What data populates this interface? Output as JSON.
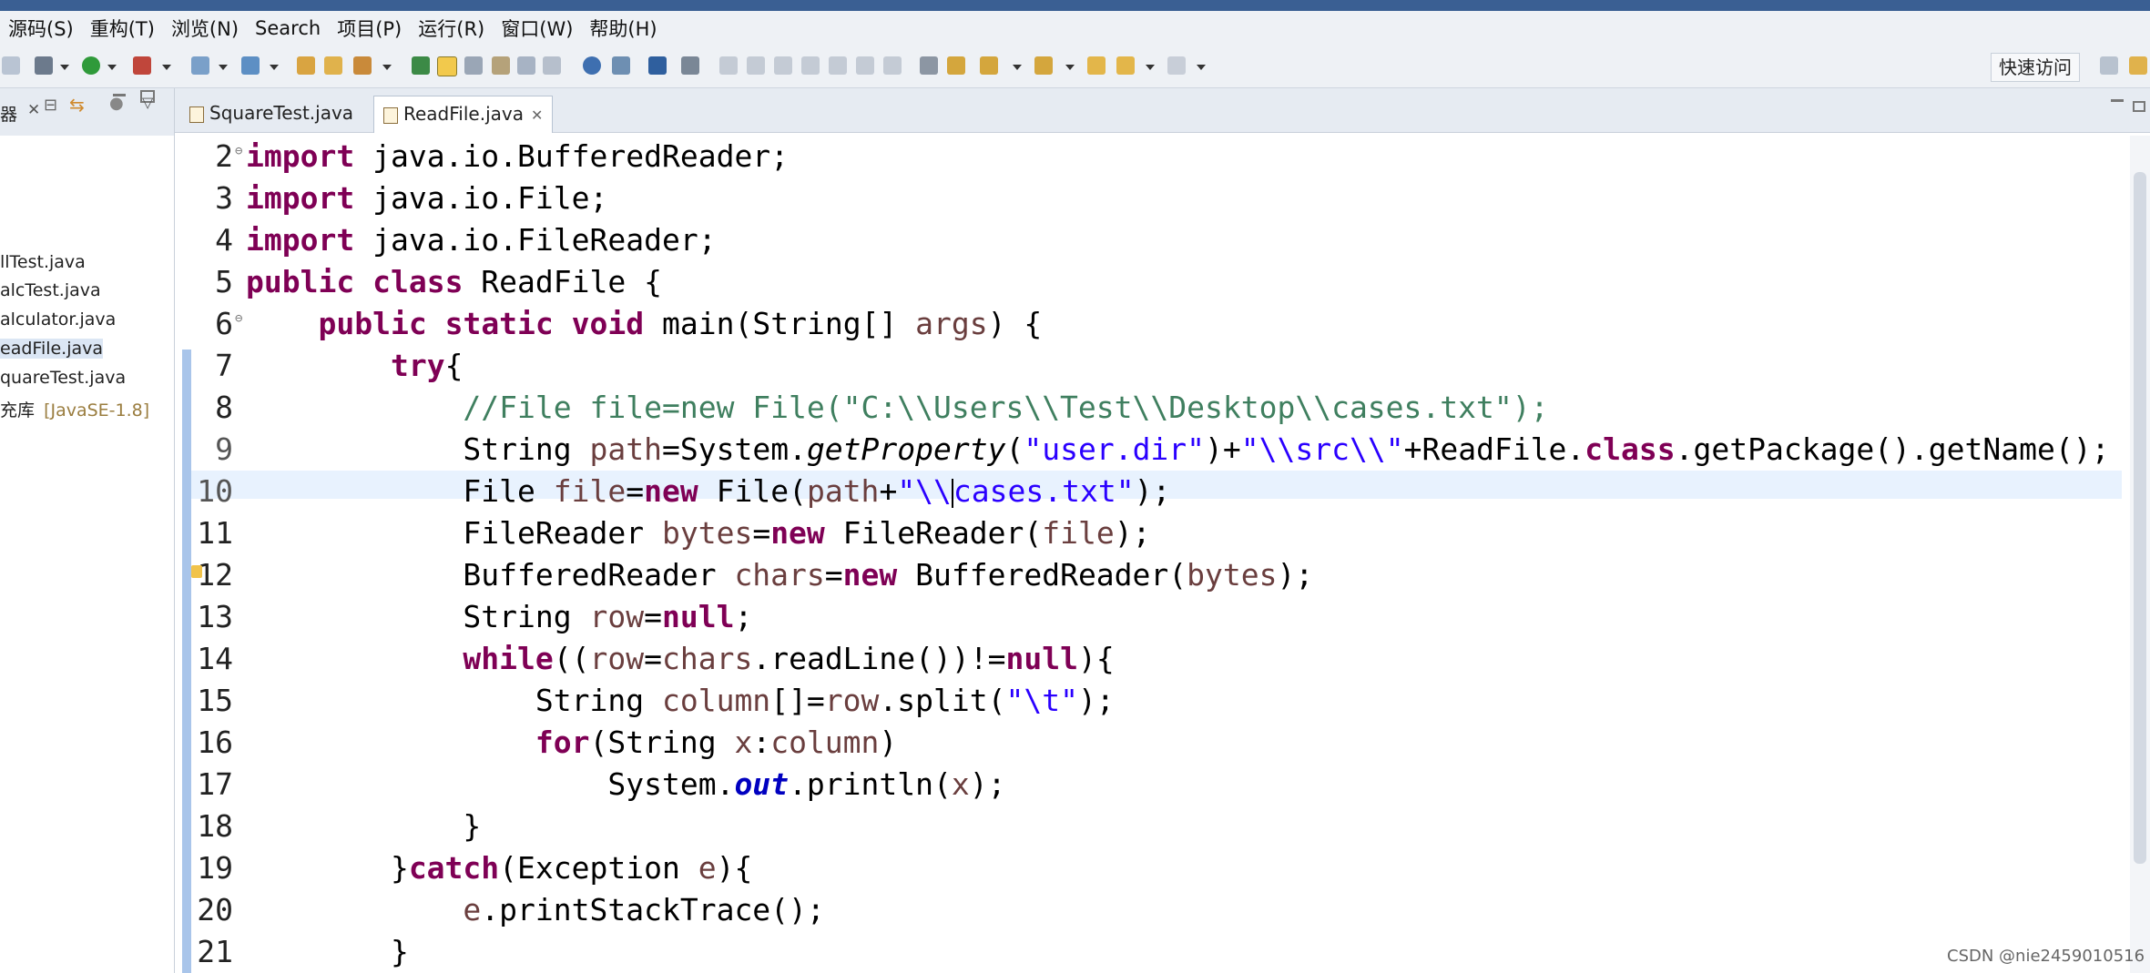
{
  "menubar": {
    "items": [
      "源码(S)",
      "重构(T)",
      "浏览(N)",
      "Search",
      "项目(P)",
      "运行(R)",
      "窗口(W)",
      "帮助(H)"
    ]
  },
  "toolbar": {
    "quick_access": "快速访问"
  },
  "left_panel": {
    "title": "器",
    "items": [
      {
        "label": "llTest.java"
      },
      {
        "label": "alcTest.java"
      },
      {
        "label": "alculator.java"
      },
      {
        "label": "eadFile.java"
      },
      {
        "label": "quareTest.java"
      },
      {
        "label": "充库",
        "suffix": "[JavaSE-1.8]"
      }
    ]
  },
  "tabs": [
    {
      "label": "SquareTest.java"
    },
    {
      "label": "ReadFile.java"
    }
  ],
  "code_lines": [
    {
      "n": "2",
      "segs": [
        {
          "c": "kw",
          "t": "import"
        },
        {
          "c": "",
          "t": " java.io.BufferedReader;"
        }
      ]
    },
    {
      "n": "3",
      "segs": [
        {
          "c": "kw",
          "t": "import"
        },
        {
          "c": "",
          "t": " java.io.File;"
        }
      ]
    },
    {
      "n": "4",
      "segs": [
        {
          "c": "kw",
          "t": "import"
        },
        {
          "c": "",
          "t": " java.io.FileReader;"
        }
      ]
    },
    {
      "n": "5",
      "segs": [
        {
          "c": "kw",
          "t": "public"
        },
        {
          "c": "",
          "t": " "
        },
        {
          "c": "kw",
          "t": "class"
        },
        {
          "c": "",
          "t": " ReadFile {"
        }
      ]
    },
    {
      "n": "6",
      "segs": [
        {
          "c": "",
          "t": "    "
        },
        {
          "c": "kw",
          "t": "public"
        },
        {
          "c": "",
          "t": " "
        },
        {
          "c": "kw",
          "t": "static"
        },
        {
          "c": "",
          "t": " "
        },
        {
          "c": "kw",
          "t": "void"
        },
        {
          "c": "",
          "t": " main(String[] "
        },
        {
          "c": "var",
          "t": "args"
        },
        {
          "c": "",
          "t": ") {"
        }
      ]
    },
    {
      "n": "7",
      "segs": [
        {
          "c": "",
          "t": "        "
        },
        {
          "c": "kw",
          "t": "try"
        },
        {
          "c": "",
          "t": "{"
        }
      ]
    },
    {
      "n": "8",
      "segs": [
        {
          "c": "",
          "t": "            "
        },
        {
          "c": "cmt",
          "t": "//File file=new File(\"C:\\\\Users\\\\Test\\\\Desktop\\\\cases.txt\");"
        }
      ]
    },
    {
      "n": "9",
      "segs": [
        {
          "c": "",
          "t": "            String "
        },
        {
          "c": "var",
          "t": "path"
        },
        {
          "c": "",
          "t": "=System."
        },
        {
          "c": "it",
          "t": "getProperty"
        },
        {
          "c": "",
          "t": "("
        },
        {
          "c": "str",
          "t": "\"user.dir\""
        },
        {
          "c": "",
          "t": ")+"
        },
        {
          "c": "str",
          "t": "\"\\\\src\\\\\""
        },
        {
          "c": "",
          "t": "+ReadFile."
        },
        {
          "c": "kw",
          "t": "class"
        },
        {
          "c": "",
          "t": ".getPackage().getName();"
        }
      ]
    },
    {
      "n": "10",
      "segs": [
        {
          "c": "",
          "t": "            File "
        },
        {
          "c": "var",
          "t": "file"
        },
        {
          "c": "",
          "t": "="
        },
        {
          "c": "kw",
          "t": "new"
        },
        {
          "c": "",
          "t": " File("
        },
        {
          "c": "var",
          "t": "path"
        },
        {
          "c": "",
          "t": "+"
        },
        {
          "c": "str",
          "t": "\"\\\\"
        },
        {
          "c": "cursor",
          "t": ""
        },
        {
          "c": "str",
          "t": "cases.txt\""
        },
        {
          "c": "",
          "t": ");"
        }
      ]
    },
    {
      "n": "11",
      "segs": [
        {
          "c": "",
          "t": "            FileReader "
        },
        {
          "c": "var",
          "t": "bytes"
        },
        {
          "c": "",
          "t": "="
        },
        {
          "c": "kw",
          "t": "new"
        },
        {
          "c": "",
          "t": " FileReader("
        },
        {
          "c": "var",
          "t": "file"
        },
        {
          "c": "",
          "t": ");"
        }
      ]
    },
    {
      "n": "12",
      "segs": [
        {
          "c": "",
          "t": "            BufferedReader "
        },
        {
          "c": "var",
          "t": "chars"
        },
        {
          "c": "",
          "t": "="
        },
        {
          "c": "kw",
          "t": "new"
        },
        {
          "c": "",
          "t": " BufferedReader("
        },
        {
          "c": "var",
          "t": "bytes"
        },
        {
          "c": "",
          "t": ");"
        }
      ]
    },
    {
      "n": "13",
      "segs": [
        {
          "c": "",
          "t": "            String "
        },
        {
          "c": "var",
          "t": "row"
        },
        {
          "c": "",
          "t": "="
        },
        {
          "c": "kw",
          "t": "null"
        },
        {
          "c": "",
          "t": ";"
        }
      ]
    },
    {
      "n": "14",
      "segs": [
        {
          "c": "",
          "t": "            "
        },
        {
          "c": "kw",
          "t": "while"
        },
        {
          "c": "",
          "t": "(("
        },
        {
          "c": "var",
          "t": "row"
        },
        {
          "c": "",
          "t": "="
        },
        {
          "c": "var",
          "t": "chars"
        },
        {
          "c": "",
          "t": ".readLine())!="
        },
        {
          "c": "kw",
          "t": "null"
        },
        {
          "c": "",
          "t": "){"
        }
      ]
    },
    {
      "n": "15",
      "segs": [
        {
          "c": "",
          "t": "                String "
        },
        {
          "c": "var",
          "t": "column"
        },
        {
          "c": "",
          "t": "[]="
        },
        {
          "c": "var",
          "t": "row"
        },
        {
          "c": "",
          "t": ".split("
        },
        {
          "c": "str",
          "t": "\"\\t\""
        },
        {
          "c": "",
          "t": ");"
        }
      ]
    },
    {
      "n": "16",
      "segs": [
        {
          "c": "",
          "t": "                "
        },
        {
          "c": "kw",
          "t": "for"
        },
        {
          "c": "",
          "t": "(String "
        },
        {
          "c": "var",
          "t": "x"
        },
        {
          "c": "",
          "t": ":"
        },
        {
          "c": "var",
          "t": "column"
        },
        {
          "c": "",
          "t": ")"
        }
      ]
    },
    {
      "n": "17",
      "segs": [
        {
          "c": "",
          "t": "                    System."
        },
        {
          "c": "fld",
          "t": "out"
        },
        {
          "c": "",
          "t": ".println("
        },
        {
          "c": "var",
          "t": "x"
        },
        {
          "c": "",
          "t": ");"
        }
      ]
    },
    {
      "n": "18",
      "segs": [
        {
          "c": "",
          "t": "            }"
        }
      ]
    },
    {
      "n": "19",
      "segs": [
        {
          "c": "",
          "t": "        }"
        },
        {
          "c": "kw",
          "t": "catch"
        },
        {
          "c": "",
          "t": "(Exception "
        },
        {
          "c": "var",
          "t": "e"
        },
        {
          "c": "",
          "t": "){"
        }
      ]
    },
    {
      "n": "20",
      "segs": [
        {
          "c": "",
          "t": "            "
        },
        {
          "c": "var",
          "t": "e"
        },
        {
          "c": "",
          "t": ".printStackTrace();"
        }
      ]
    },
    {
      "n": "21",
      "segs": [
        {
          "c": "",
          "t": "        }"
        }
      ]
    }
  ],
  "watermark": "CSDN @nie2459010516"
}
